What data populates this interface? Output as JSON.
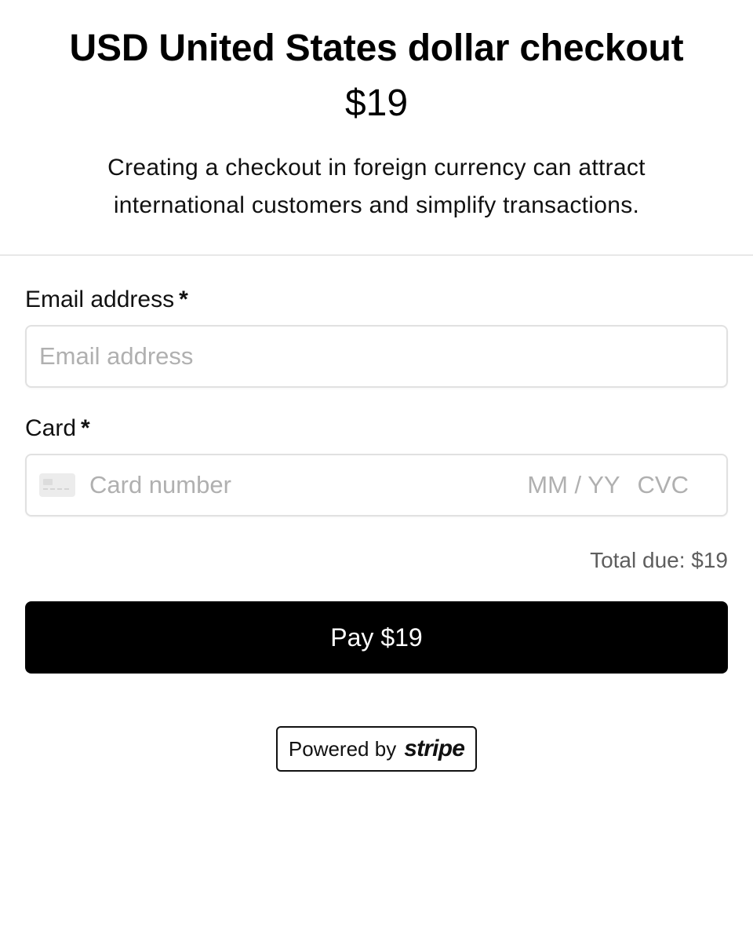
{
  "header": {
    "title": "USD United States dollar checkout",
    "price": "$19",
    "description": "Creating a checkout in foreign currency can attract international customers and simplify transactions."
  },
  "form": {
    "email": {
      "label": "Email address",
      "required_mark": "*",
      "placeholder": "Email address",
      "value": ""
    },
    "card": {
      "label": "Card",
      "required_mark": "*",
      "icon": "credit-card-icon",
      "number_placeholder": "Card number",
      "expiry_placeholder": "MM / YY",
      "cvc_placeholder": "CVC"
    }
  },
  "summary": {
    "total_due": "Total due: $19"
  },
  "pay_button": {
    "label": "Pay $19",
    "color": "#000000"
  },
  "footer": {
    "powered_by": "Powered by",
    "brand": "stripe"
  }
}
